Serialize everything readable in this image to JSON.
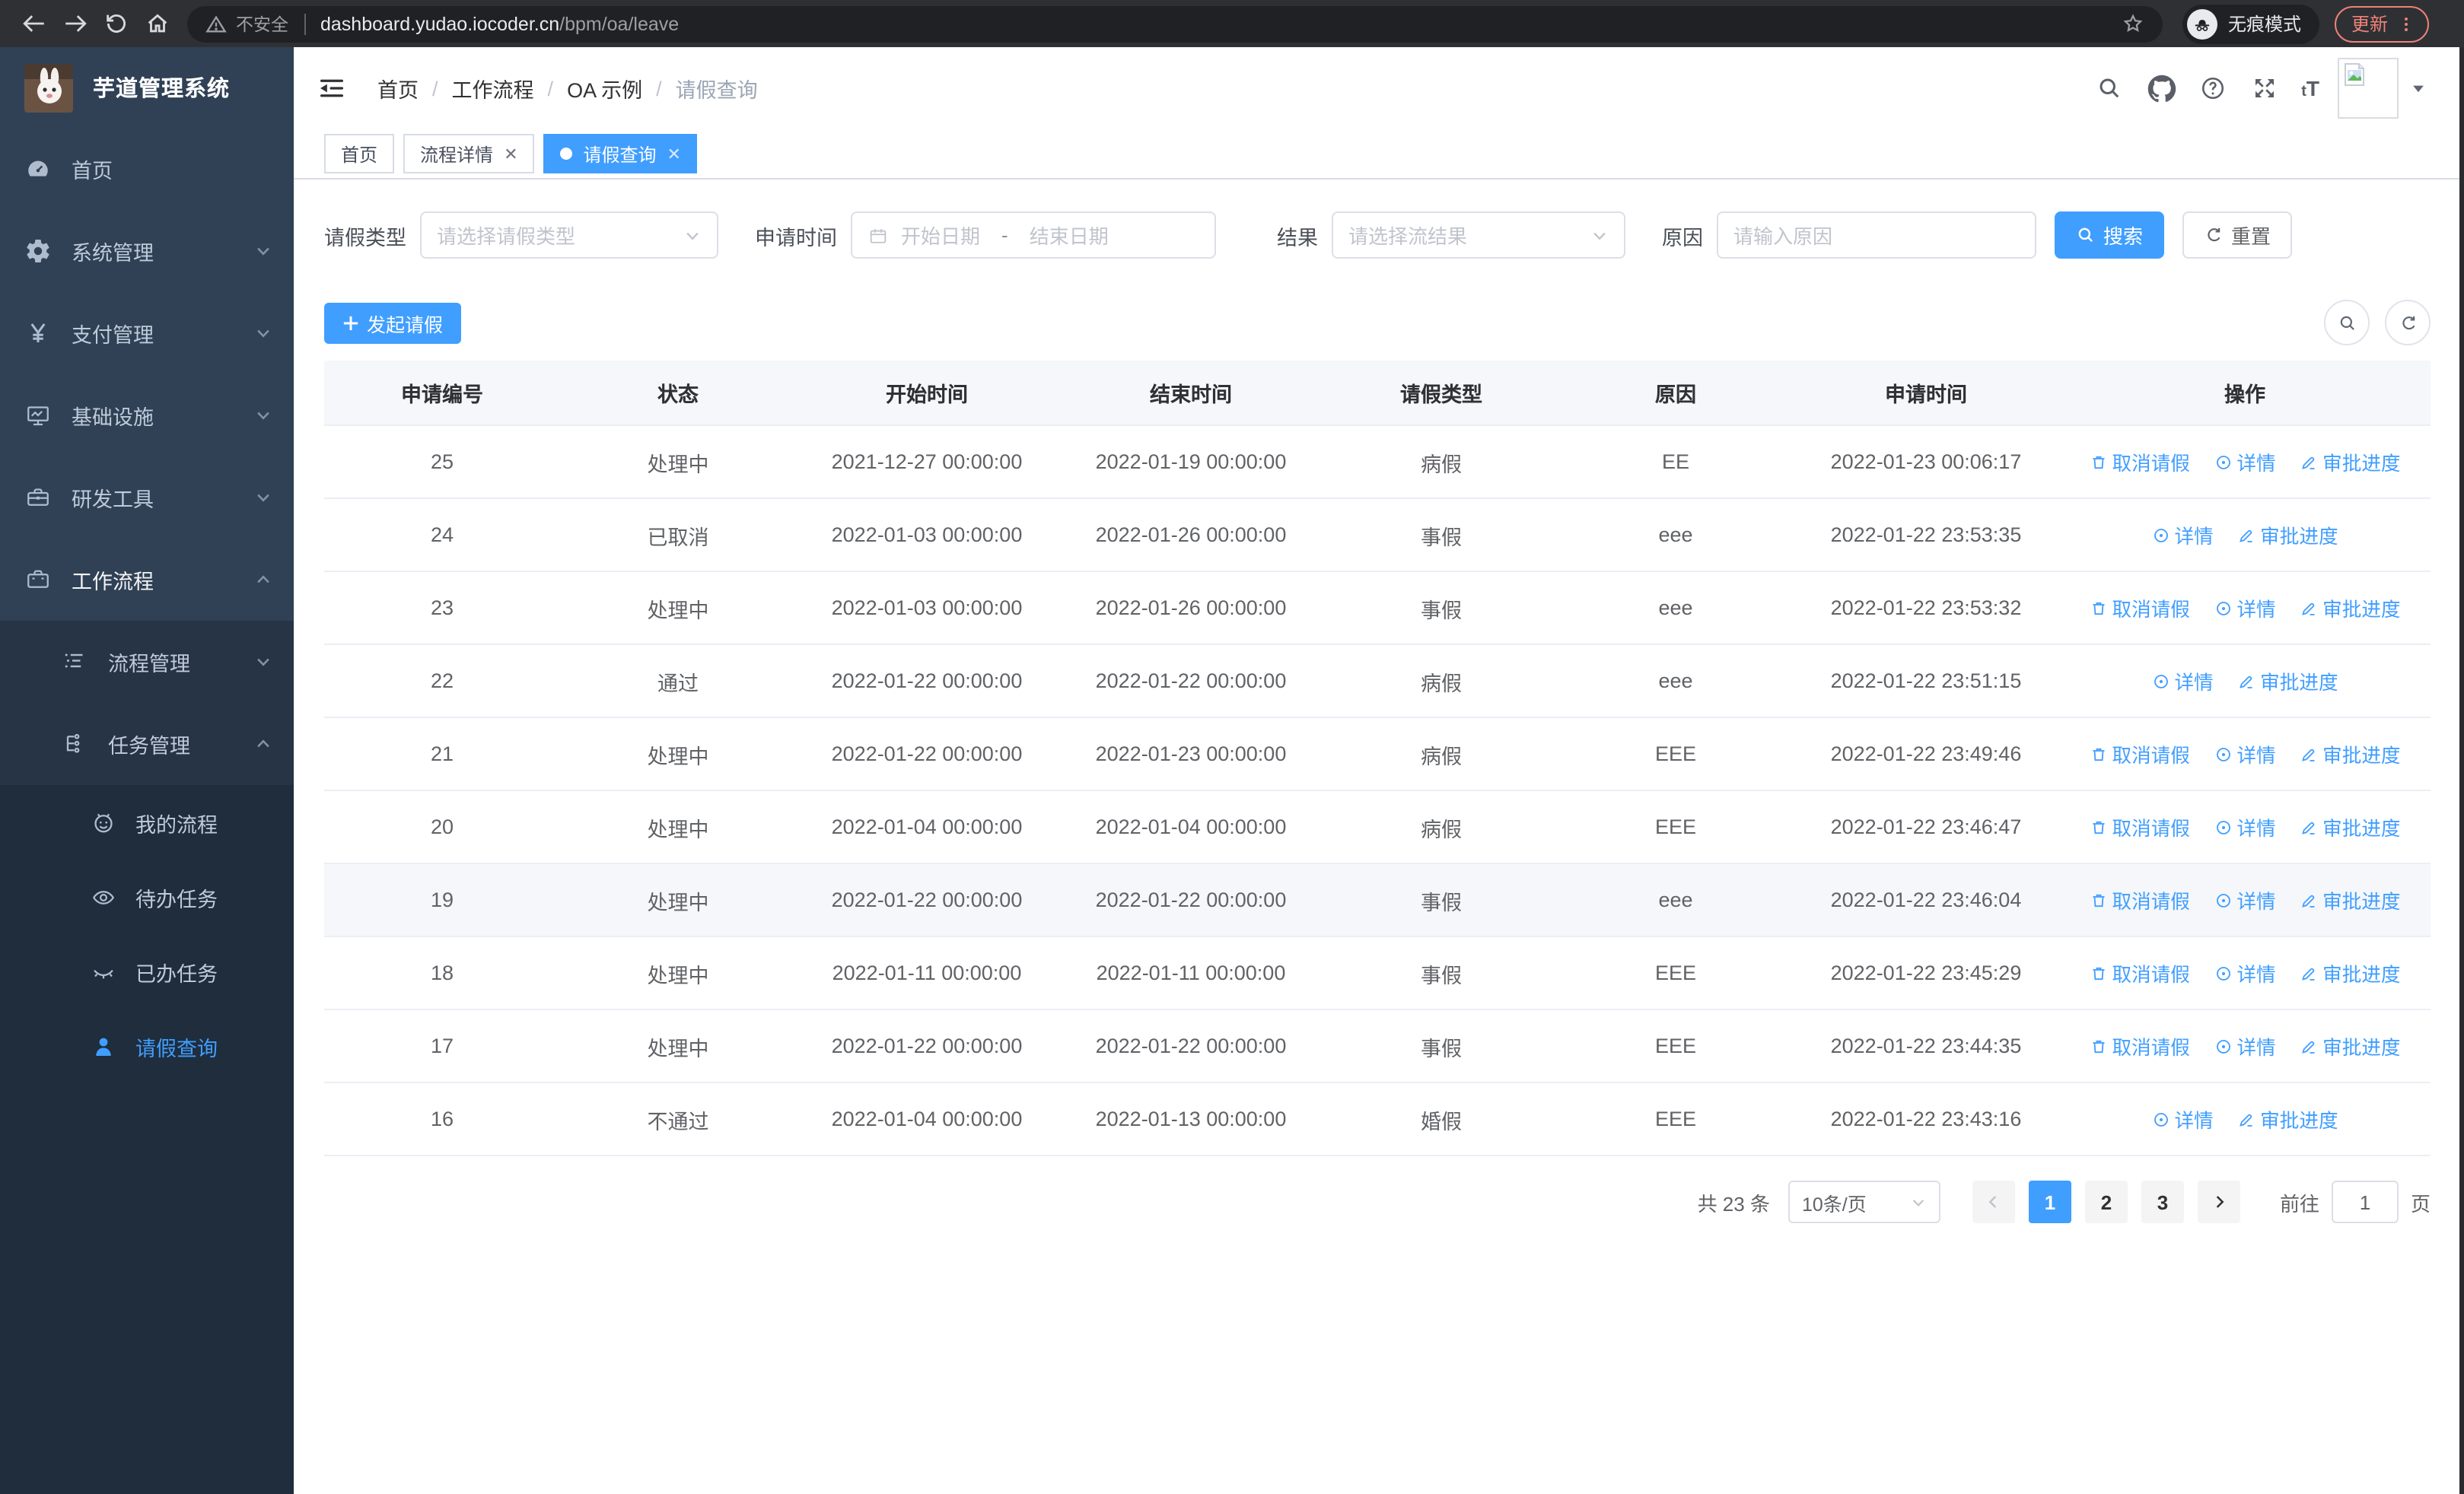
{
  "browser": {
    "security_label": "不安全",
    "url_host": "dashboard.yudao.iocoder.cn",
    "url_path": "/bpm/oa/leave",
    "incognito_label": "无痕模式",
    "update_label": "更新"
  },
  "sidebar": {
    "app_title": "芋道管理系统",
    "menu": [
      {
        "label": "首页"
      },
      {
        "label": "系统管理"
      },
      {
        "label": "支付管理"
      },
      {
        "label": "基础设施"
      },
      {
        "label": "研发工具"
      },
      {
        "label": "工作流程"
      },
      {
        "label": "流程管理"
      },
      {
        "label": "任务管理"
      },
      {
        "label": "我的流程"
      },
      {
        "label": "待办任务"
      },
      {
        "label": "已办任务"
      },
      {
        "label": "请假查询"
      }
    ]
  },
  "breadcrumb": [
    "首页",
    "工作流程",
    "OA 示例",
    "请假查询"
  ],
  "tabs": [
    {
      "label": "首页"
    },
    {
      "label": "流程详情"
    },
    {
      "label": "请假查询"
    }
  ],
  "filters": {
    "leave_type_label": "请假类型",
    "leave_type_placeholder": "请选择请假类型",
    "apply_time_label": "申请时间",
    "start_date_placeholder": "开始日期",
    "date_separator": "-",
    "end_date_placeholder": "结束日期",
    "result_label": "结果",
    "result_placeholder": "请选择流结果",
    "reason_label": "原因",
    "reason_placeholder": "请输入原因",
    "search_label": "搜索",
    "reset_label": "重置"
  },
  "toolbar": {
    "create_label": "发起请假"
  },
  "table": {
    "columns": [
      "申请编号",
      "状态",
      "开始时间",
      "结束时间",
      "请假类型",
      "原因",
      "申请时间",
      "操作"
    ],
    "action_labels": {
      "cancel": "取消请假",
      "detail": "详情",
      "progress": "审批进度"
    },
    "rows": [
      {
        "id": "25",
        "status": "处理中",
        "start": "2021-12-27 00:00:00",
        "end": "2022-01-19 00:00:00",
        "type": "病假",
        "reason": "EE",
        "applied": "2022-01-23 00:06:17",
        "actions": [
          "cancel",
          "detail",
          "progress"
        ],
        "highlight": false
      },
      {
        "id": "24",
        "status": "已取消",
        "start": "2022-01-03 00:00:00",
        "end": "2022-01-26 00:00:00",
        "type": "事假",
        "reason": "eee",
        "applied": "2022-01-22 23:53:35",
        "actions": [
          "detail",
          "progress"
        ],
        "highlight": false
      },
      {
        "id": "23",
        "status": "处理中",
        "start": "2022-01-03 00:00:00",
        "end": "2022-01-26 00:00:00",
        "type": "事假",
        "reason": "eee",
        "applied": "2022-01-22 23:53:32",
        "actions": [
          "cancel",
          "detail",
          "progress"
        ],
        "highlight": false
      },
      {
        "id": "22",
        "status": "通过",
        "start": "2022-01-22 00:00:00",
        "end": "2022-01-22 00:00:00",
        "type": "病假",
        "reason": "eee",
        "applied": "2022-01-22 23:51:15",
        "actions": [
          "detail",
          "progress"
        ],
        "highlight": false
      },
      {
        "id": "21",
        "status": "处理中",
        "start": "2022-01-22 00:00:00",
        "end": "2022-01-23 00:00:00",
        "type": "病假",
        "reason": "EEE",
        "applied": "2022-01-22 23:49:46",
        "actions": [
          "cancel",
          "detail",
          "progress"
        ],
        "highlight": false
      },
      {
        "id": "20",
        "status": "处理中",
        "start": "2022-01-04 00:00:00",
        "end": "2022-01-04 00:00:00",
        "type": "病假",
        "reason": "EEE",
        "applied": "2022-01-22 23:46:47",
        "actions": [
          "cancel",
          "detail",
          "progress"
        ],
        "highlight": false
      },
      {
        "id": "19",
        "status": "处理中",
        "start": "2022-01-22 00:00:00",
        "end": "2022-01-22 00:00:00",
        "type": "事假",
        "reason": "eee",
        "applied": "2022-01-22 23:46:04",
        "actions": [
          "cancel",
          "detail",
          "progress"
        ],
        "highlight": true
      },
      {
        "id": "18",
        "status": "处理中",
        "start": "2022-01-11 00:00:00",
        "end": "2022-01-11 00:00:00",
        "type": "事假",
        "reason": "EEE",
        "applied": "2022-01-22 23:45:29",
        "actions": [
          "cancel",
          "detail",
          "progress"
        ],
        "highlight": false
      },
      {
        "id": "17",
        "status": "处理中",
        "start": "2022-01-22 00:00:00",
        "end": "2022-01-22 00:00:00",
        "type": "事假",
        "reason": "EEE",
        "applied": "2022-01-22 23:44:35",
        "actions": [
          "cancel",
          "detail",
          "progress"
        ],
        "highlight": false
      },
      {
        "id": "16",
        "status": "不通过",
        "start": "2022-01-04 00:00:00",
        "end": "2022-01-13 00:00:00",
        "type": "婚假",
        "reason": "EEE",
        "applied": "2022-01-22 23:43:16",
        "actions": [
          "detail",
          "progress"
        ],
        "highlight": false
      }
    ]
  },
  "pagination": {
    "total_label": "共 23 条",
    "page_size_label": "10条/页",
    "pages": [
      "1",
      "2",
      "3"
    ],
    "active_page": "1",
    "goto_label": "前往",
    "goto_value": "1",
    "unit_label": "页"
  },
  "colors": {
    "accent": "#409eff",
    "sidebar_bg": "#304156",
    "submenu_bg": "#1f2d3d"
  }
}
